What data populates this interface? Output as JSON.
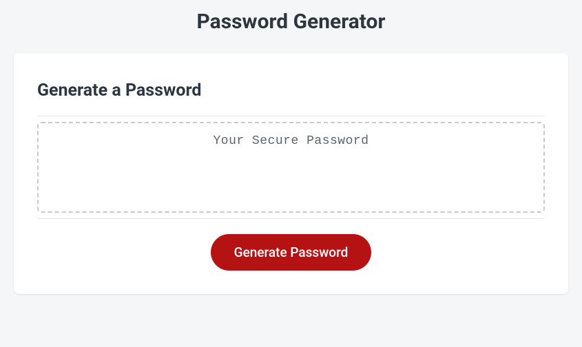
{
  "page": {
    "title": "Password Generator"
  },
  "card": {
    "heading": "Generate a Password",
    "output_placeholder": "Your Secure Password",
    "generate_button_label": "Generate Password"
  }
}
